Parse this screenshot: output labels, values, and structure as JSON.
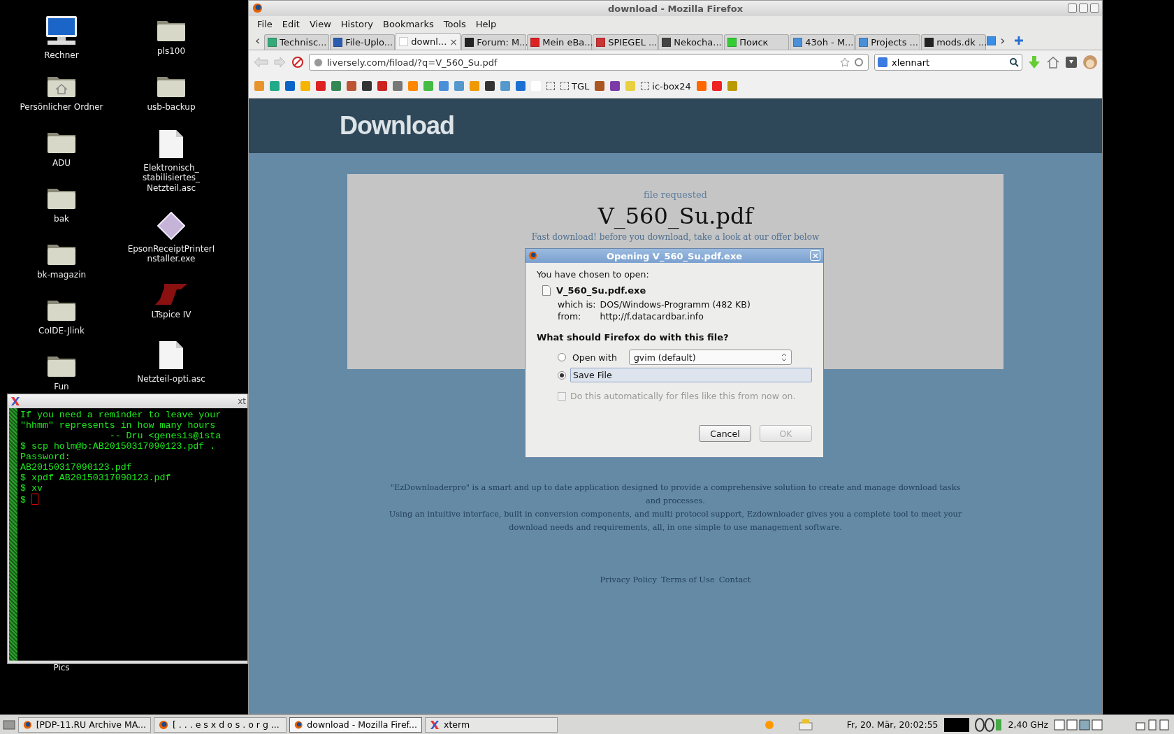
{
  "desktop": {
    "columns": [
      [
        {
          "label": "Rechner",
          "kind": "computer"
        },
        {
          "label": "Persönlicher Ordner",
          "kind": "home"
        },
        {
          "label": "ADU",
          "kind": "folder"
        },
        {
          "label": "bak",
          "kind": "folder"
        },
        {
          "label": "bk-magazin",
          "kind": "folder"
        },
        {
          "label": "CoIDE-Jlink",
          "kind": "folder"
        },
        {
          "label": "Fun",
          "kind": "folder"
        }
      ],
      [
        {
          "label": "pls100",
          "kind": "folder"
        },
        {
          "label": "usb-backup",
          "kind": "folder"
        },
        {
          "label": "Elektronisch_ stabilisiertes_ Netzteil.asc",
          "kind": "document"
        },
        {
          "label": "EpsonReceiptPrinterI nstaller.exe",
          "kind": "installer"
        },
        {
          "label": "LTspice IV",
          "kind": "ltspice"
        },
        {
          "label": "Netzteil-opti.asc",
          "kind": "document"
        }
      ]
    ],
    "bottom_label": "Pics"
  },
  "terminal": {
    "title": "xt",
    "lines": [
      "If you need a reminder to leave your",
      "\"hhmm\" represents in how many hours",
      "                -- Dru <genesis@ista",
      "$ scp holm@b:AB20150317090123.pdf .",
      "Password:",
      "AB20150317090123.pdf",
      "$ xpdf AB20150317090123.pdf",
      "$ xv"
    ],
    "prompt": "$"
  },
  "browser": {
    "title": "download - Mozilla Firefox",
    "menu": [
      "File",
      "Edit",
      "View",
      "History",
      "Bookmarks",
      "Tools",
      "Help"
    ],
    "tabs": [
      {
        "label": "Technisc...",
        "selected": false
      },
      {
        "label": "File-Uplo...",
        "selected": false
      },
      {
        "label": "downl...",
        "selected": true
      },
      {
        "label": "Forum: M...",
        "selected": false
      },
      {
        "label": "Mein eBa...",
        "selected": false
      },
      {
        "label": "SPIEGEL ...",
        "selected": false
      },
      {
        "label": "Nekocha...",
        "selected": false
      },
      {
        "label": "Поиск",
        "selected": false
      },
      {
        "label": "43oh - M...",
        "selected": false
      },
      {
        "label": "Projects ...",
        "selected": false
      },
      {
        "label": "mods.dk ...",
        "selected": false
      }
    ],
    "tab_close": "×",
    "tab_scroll_left": "‹",
    "tab_scroll_right": "›",
    "url": "liversely.com/fiload/?q=V_560_Su.pdf",
    "search": {
      "value": "xlennart"
    },
    "bookmarks": [
      {
        "label": "TGL"
      },
      {
        "label": "ic-box24"
      }
    ],
    "page": {
      "header": "Download",
      "card_caption": "file requested",
      "file_name": "V_560_Su.pdf",
      "offer": "Fast download! before you download, take a look at our offer below",
      "paragraphs": [
        "\"EzDownloaderpro\" is a smart and up to date application designed to provide a comprehensive solution to create and manage download tasks and processes.",
        "Using an intuitive interface, built in conversion components, and multi protocol support, Ezdownloader gives you a complete tool to meet your download needs and requirements, all, in one simple to use management software."
      ],
      "footer_links": [
        "Privacy Policy",
        "Terms of Use",
        "Contact"
      ]
    }
  },
  "dialog": {
    "title": "Opening V_560_Su.pdf.exe",
    "intro": "You have chosen to open:",
    "file": "V_560_Su.pdf.exe",
    "type_label": "which is:",
    "type": "DOS/Windows-Programm (482 KB)",
    "from_label": "from:",
    "from": "http://f.datacardbar.info",
    "question": "What should Firefox do with this file?",
    "options": [
      {
        "label": "Open with",
        "selected": false
      },
      {
        "label": "Save File",
        "selected": true
      }
    ],
    "app": "gvim (default)",
    "auto": {
      "label": "Do this automatically for files like this from now on.",
      "checked": false,
      "disabled": true
    },
    "buttons": [
      {
        "label": "Cancel",
        "disabled": false
      },
      {
        "label": "OK",
        "disabled": true
      }
    ]
  },
  "taskbar": {
    "tasks": [
      {
        "label": "[PDP-11.RU Archive MA...",
        "selected": false
      },
      {
        "label": "[ . . . e s x d o s . o r g ...",
        "selected": false
      },
      {
        "label": "download - Mozilla Firef...",
        "selected": true
      },
      {
        "label": "xterm",
        "selected": false
      }
    ],
    "clock": "Fr, 20. Mär, 20:02:55",
    "cpu": "2,40 GHz"
  }
}
